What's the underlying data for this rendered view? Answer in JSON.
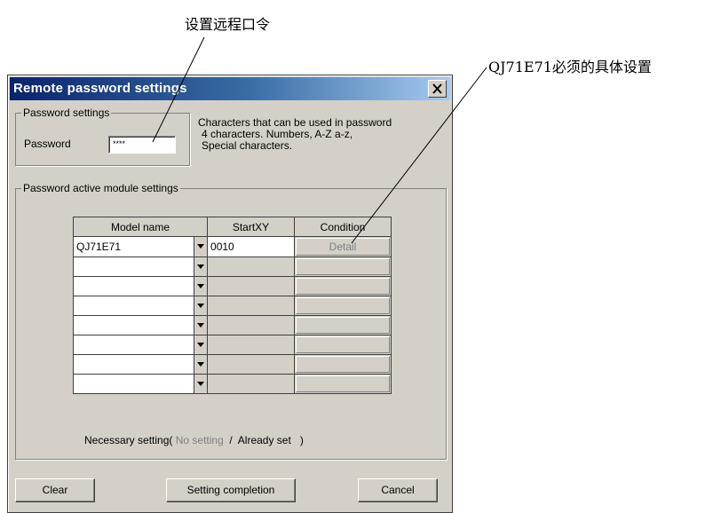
{
  "annotations": {
    "remote_password": "设置远程口令",
    "qj71e71_setting": "QJ71E71必须的具体设置"
  },
  "dialog": {
    "title": "Remote password settings",
    "close_icon": "close-icon"
  },
  "password_group": {
    "legend": "Password settings",
    "label": "Password",
    "value": "****"
  },
  "note": {
    "line1": "Characters that can be used in password",
    "line2": "4 characters. Numbers, A-Z a-z,",
    "line3": "Special characters."
  },
  "module_group": {
    "legend": "Password active module settings",
    "columns": [
      "Model name",
      "StartXY",
      "Condition"
    ],
    "rows": [
      {
        "model": "QJ71E71",
        "start": "0010",
        "condition": "Detail"
      },
      {
        "model": "",
        "start": "",
        "condition": ""
      },
      {
        "model": "",
        "start": "",
        "condition": ""
      },
      {
        "model": "",
        "start": "",
        "condition": ""
      },
      {
        "model": "",
        "start": "",
        "condition": ""
      },
      {
        "model": "",
        "start": "",
        "condition": ""
      },
      {
        "model": "",
        "start": "",
        "condition": ""
      },
      {
        "model": "",
        "start": "",
        "condition": ""
      }
    ]
  },
  "necessary": {
    "prefix": "Necessary setting(",
    "no_setting": "No setting",
    "separator": "/",
    "already_set": "Already set",
    "suffix": ")"
  },
  "buttons": {
    "clear": "Clear",
    "setting_completion": "Setting completion",
    "cancel": "Cancel"
  }
}
